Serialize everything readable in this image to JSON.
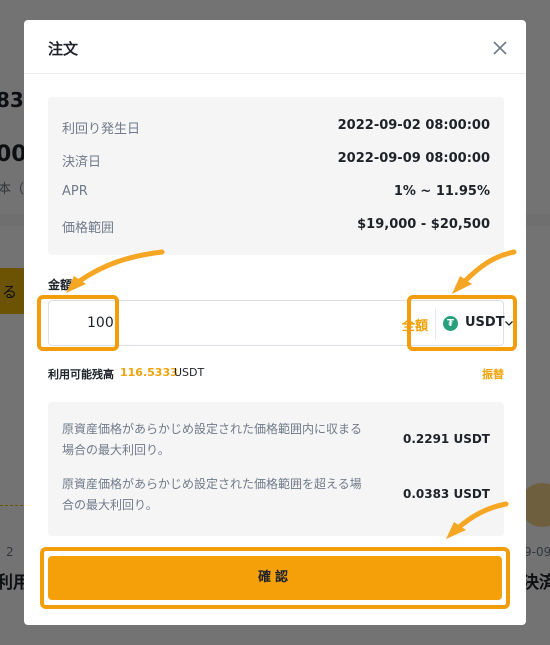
{
  "background": {
    "frag1": "83",
    "frag2": "00",
    "frag3": "本（",
    "frag_button": "る",
    "frag_bottom_left_top": "2",
    "frag_bottom_left": "利用",
    "frag_bottom_right_top": "9-09",
    "frag_bottom_right": "決済"
  },
  "modal": {
    "title": "注文",
    "close_icon": "close-icon"
  },
  "info": [
    {
      "label": "利回り発生日",
      "value": "2022-09-02 08:00:00"
    },
    {
      "label": "決済日",
      "value": "2022-09-09 08:00:00"
    },
    {
      "label": "APR",
      "value": "1% ~ 11.95%"
    },
    {
      "label": "価格範囲",
      "value": "$19,000 - $20,500"
    }
  ],
  "amount": {
    "label": "金額",
    "value": "100",
    "all_label": "全額",
    "currency": "USDT",
    "currency_icon": "₮"
  },
  "balance": {
    "label": "利用可能残高",
    "value": "116.5333",
    "unit": "USDT",
    "transfer_label": "振替"
  },
  "yield": [
    {
      "desc": "原資産価格があらかじめ設定された価格範囲内に収まる場合の最大利回り。",
      "value": "0.2291 USDT"
    },
    {
      "desc": "原資産価格があらかじめ設定された価格範囲を超える場合の最大利回り。",
      "value": "0.0383 USDT"
    }
  ],
  "confirm_label": "確認",
  "colors": {
    "accent": "#f5a009",
    "highlight": "#f39c0c",
    "usdt": "#26a17b"
  }
}
